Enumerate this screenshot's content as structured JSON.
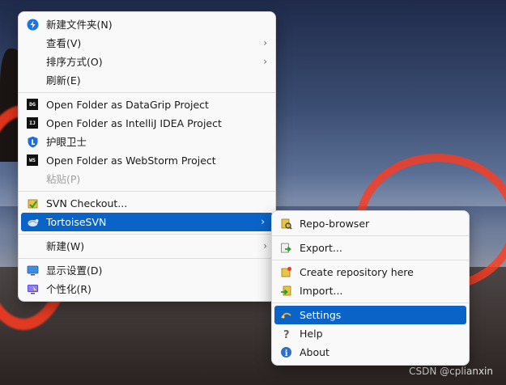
{
  "main_menu": {
    "items": [
      {
        "label": "新建文件夹(N)"
      },
      {
        "label": "查看(V)"
      },
      {
        "label": "排序方式(O)"
      },
      {
        "label": "刷新(E)"
      },
      {
        "label": "Open Folder as DataGrip Project",
        "badge": "DG"
      },
      {
        "label": "Open Folder as IntelliJ IDEA Project",
        "badge": "IJ"
      },
      {
        "label": "护眼卫士"
      },
      {
        "label": "Open Folder as WebStorm Project",
        "badge": "WS"
      },
      {
        "label": "粘贴(P)"
      },
      {
        "label": "SVN Checkout..."
      },
      {
        "label": "TortoiseSVN"
      },
      {
        "label": "新建(W)"
      },
      {
        "label": "显示设置(D)"
      },
      {
        "label": "个性化(R)"
      }
    ]
  },
  "submenu": {
    "items": [
      {
        "label": "Repo-browser"
      },
      {
        "label": "Export..."
      },
      {
        "label": "Create repository here"
      },
      {
        "label": "Import..."
      },
      {
        "label": "Settings"
      },
      {
        "label": "Help"
      },
      {
        "label": "About"
      }
    ]
  },
  "colors": {
    "highlight": "#0a64c8",
    "menu_bg": "#f9f9f9"
  },
  "watermark": "CSDN @cplianxin"
}
